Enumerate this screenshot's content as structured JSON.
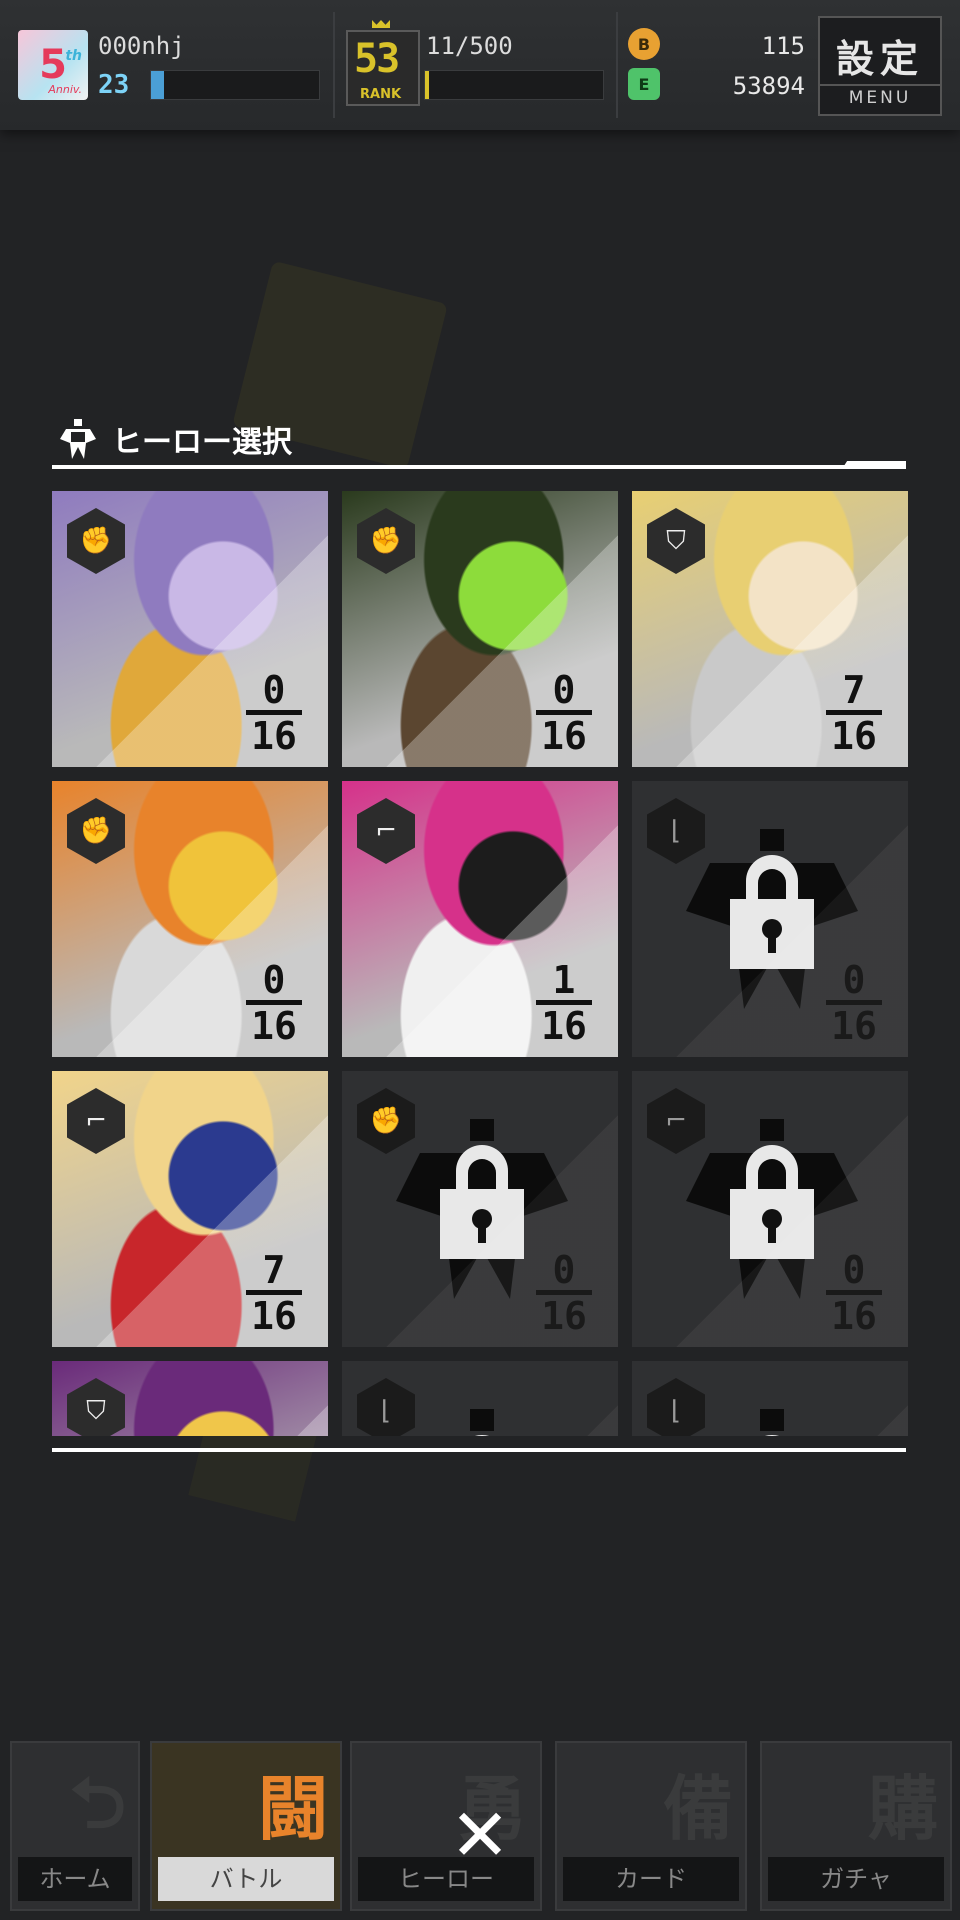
{
  "player": {
    "anniversary_badge": "5th Anniv.",
    "anniv_number": "5",
    "anniv_th": "th",
    "anniv_text": "Anniv.",
    "name": "000nhj",
    "level": "23"
  },
  "rank": {
    "badge_number": "53",
    "badge_label": "RANK",
    "progress_text": "11/500",
    "progress": 0.022
  },
  "currency": {
    "coin_icon": "B",
    "coin_value": "115",
    "energy_icon": "E",
    "energy_value": "53894"
  },
  "menu_button": {
    "kanji": "設定",
    "label": "MENU"
  },
  "modal": {
    "title": "ヒーロー選択",
    "title_icon": "hero-icon"
  },
  "heroes": [
    {
      "role_icon": "fist-icon",
      "owned": "0",
      "total": "16",
      "locked": false,
      "palette": [
        "#8f7bbf",
        "#c9b8e6",
        "#e0a83a"
      ]
    },
    {
      "role_icon": "fist-icon",
      "owned": "0",
      "total": "16",
      "locked": false,
      "palette": [
        "#2a3a1d",
        "#8ddc3b",
        "#5b4630"
      ]
    },
    {
      "role_icon": "shield-icon",
      "owned": "7",
      "total": "16",
      "locked": false,
      "palette": [
        "#e8cf72",
        "#f3e3c6",
        "#c9c9c9"
      ]
    },
    {
      "role_icon": "fist-icon",
      "owned": "0",
      "total": "16",
      "locked": false,
      "palette": [
        "#e8832b",
        "#f0c33a",
        "#d9d9d9"
      ]
    },
    {
      "role_icon": "gun-icon",
      "owned": "1",
      "total": "16",
      "locked": false,
      "palette": [
        "#d6318a",
        "#1c1c1c",
        "#f0f0f0"
      ]
    },
    {
      "role_icon": "boot-icon",
      "owned": "0",
      "total": "16",
      "locked": true,
      "palette": []
    },
    {
      "role_icon": "gun-icon",
      "owned": "7",
      "total": "16",
      "locked": false,
      "palette": [
        "#f1d48a",
        "#2b3a8f",
        "#c8262b"
      ]
    },
    {
      "role_icon": "fist-icon",
      "owned": "0",
      "total": "16",
      "locked": true,
      "palette": []
    },
    {
      "role_icon": "gun-icon",
      "owned": "0",
      "total": "16",
      "locked": true,
      "palette": []
    },
    {
      "role_icon": "shield-icon",
      "owned": "",
      "total": "",
      "locked": false,
      "palette": [
        "#6a2a7a",
        "#f0c64a",
        "#c9332e"
      ]
    },
    {
      "role_icon": "boot-icon",
      "owned": "",
      "total": "",
      "locked": true,
      "palette": []
    },
    {
      "role_icon": "boot-icon",
      "owned": "",
      "total": "",
      "locked": true,
      "palette": []
    }
  ],
  "bottom_nav": [
    {
      "label": "ホーム",
      "glyph": "⮌",
      "active": false
    },
    {
      "label": "バトル",
      "glyph": "闘",
      "active": true
    },
    {
      "label": "ヒーロー",
      "glyph": "勇",
      "active": false
    },
    {
      "label": "カード",
      "glyph": "備",
      "active": false
    },
    {
      "label": "ガチャ",
      "glyph": "購",
      "active": false
    }
  ],
  "close_button": "✕",
  "colors": {
    "accent": "#e8832b",
    "rank_gold": "#d9c22a",
    "level_blue": "#7dd3f7",
    "coin_orange": "#e8a132",
    "energy_green": "#4fc36a"
  }
}
